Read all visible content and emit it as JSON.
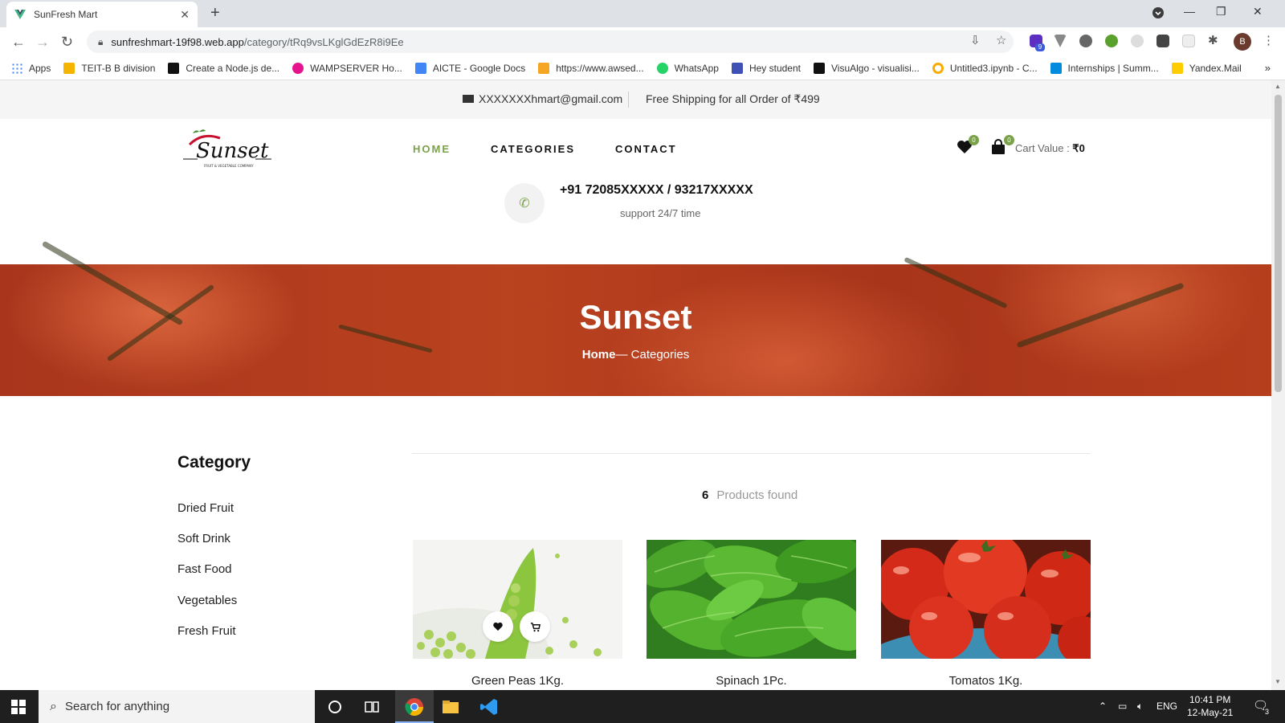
{
  "browser": {
    "tab_title": "SunFresh Mart",
    "url_domain": "sunfreshmart-19f98.web.app",
    "url_path": "/category/tRq9vsLKglGdEzR8i9Ee",
    "profile_initial": "B",
    "extension_badge": "9",
    "bookmarks": [
      {
        "label": "Apps",
        "icon": "apps-grid-icon",
        "color": "#4285f4"
      },
      {
        "label": "TEIT-B B division",
        "icon": "classroom-icon",
        "color": "#f4b400"
      },
      {
        "label": "Create a Node.js de...",
        "icon": "codepen-icon",
        "color": "#111111"
      },
      {
        "label": "WAMPSERVER Ho...",
        "icon": "wamp-icon",
        "color": "#e6138e"
      },
      {
        "label": "AICTE - Google Docs",
        "icon": "docs-icon",
        "color": "#4285f4"
      },
      {
        "label": "https://www.awsed...",
        "icon": "box-icon",
        "color": "#f5a623"
      },
      {
        "label": "WhatsApp",
        "icon": "whatsapp-icon",
        "color": "#25d366"
      },
      {
        "label": "Hey student",
        "icon": "forms-icon",
        "color": "#3f51b5"
      },
      {
        "label": "VisuAlgo - visualisi...",
        "icon": "visualgo-icon",
        "color": "#111111"
      },
      {
        "label": "Untitled3.ipynb - C...",
        "icon": "colab-icon",
        "color": "#f9ab00"
      },
      {
        "label": "Internships | Summ...",
        "icon": "internshala-icon",
        "color": "#008bdc"
      },
      {
        "label": "Yandex.Mail",
        "icon": "mail-icon",
        "color": "#ffcc00"
      }
    ]
  },
  "site": {
    "top_email": "XXXXXXXhmart@gmail.com",
    "top_shipping": "Free Shipping for all Order of ₹499",
    "logo_text": "Sunset",
    "logo_subtext": "FRUIT & VEGETABLE COMPANY",
    "nav": {
      "home": "HOME",
      "categories": "CATEGORIES",
      "contact": "CONTACT"
    },
    "wishlist_count": "0",
    "cart_count": "0",
    "cart_label": "Cart Value : ",
    "cart_value": "₹0",
    "phone": "+91 72085XXXXX / 93217XXXXX",
    "support": "support 24/7 time",
    "hero_title": "Sunset",
    "breadcrumb_home": "Home",
    "breadcrumb_sep": "—",
    "breadcrumb_current": "Categories",
    "category_heading": "Category",
    "categories": [
      "Dried Fruit",
      "Soft Drink",
      "Fast Food",
      "Vegetables",
      "Fresh Fruit"
    ],
    "products_count": "6",
    "products_found_label": "Products found",
    "products": [
      {
        "name": "Green Peas 1Kg."
      },
      {
        "name": "Spinach 1Pc."
      },
      {
        "name": "Tomatos 1Kg."
      }
    ],
    "accent_color": "#7aa14a"
  },
  "taskbar": {
    "search_placeholder": "Search for anything",
    "language": "ENG",
    "time": "10:41 PM",
    "date": "12-May-21",
    "notification_count": "3"
  }
}
